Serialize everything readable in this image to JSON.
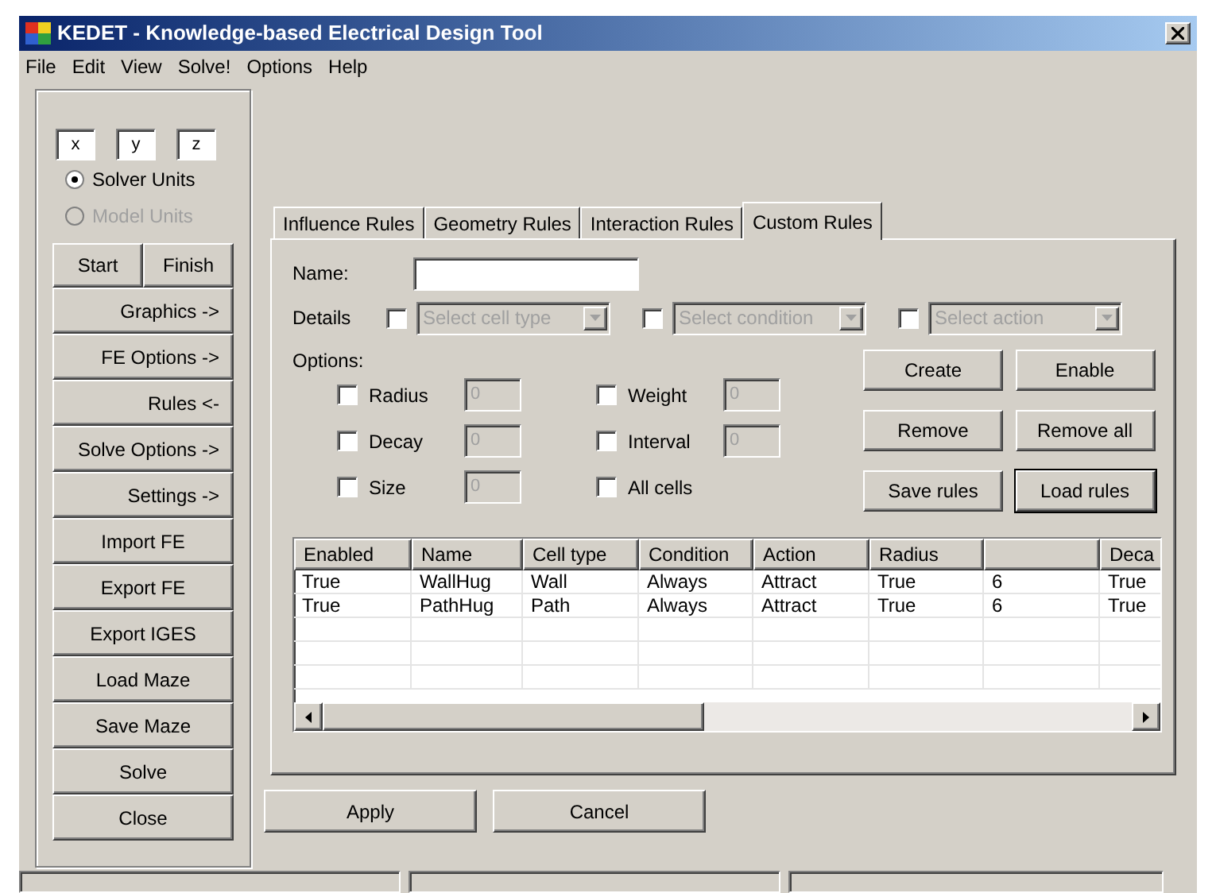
{
  "window": {
    "title": "KEDET - Knowledge-based Electrical Design Tool"
  },
  "menu": [
    "File",
    "Edit",
    "View",
    "Solve!",
    "Options",
    "Help"
  ],
  "left_panel": {
    "coordinates": [
      {
        "value": "x"
      },
      {
        "value": "y"
      },
      {
        "value": "z"
      }
    ],
    "units": [
      {
        "label": "Solver Units",
        "selected": true,
        "disabled": false
      },
      {
        "label": "Model Units",
        "selected": false,
        "disabled": true
      }
    ],
    "start_finish": [
      "Start",
      "Finish"
    ],
    "buttons": [
      {
        "label": "Graphics ->",
        "kind": "submenu"
      },
      {
        "label": "FE Options ->",
        "kind": "submenu"
      },
      {
        "label": "Rules <-",
        "kind": "submenu"
      },
      {
        "label": "Solve Options ->",
        "kind": "submenu"
      },
      {
        "label": "Settings ->",
        "kind": "submenu"
      },
      {
        "label": "Import FE",
        "kind": "action"
      },
      {
        "label": "Export FE",
        "kind": "action"
      },
      {
        "label": "Export IGES",
        "kind": "action"
      },
      {
        "label": "Load Maze",
        "kind": "action"
      },
      {
        "label": "Save Maze",
        "kind": "action"
      },
      {
        "label": "Solve",
        "kind": "action"
      },
      {
        "label": "Close",
        "kind": "action"
      }
    ]
  },
  "tabs": [
    {
      "label": "Influence Rules",
      "selected": false
    },
    {
      "label": "Geometry Rules",
      "selected": false
    },
    {
      "label": "Interaction Rules",
      "selected": false
    },
    {
      "label": "Custom Rules",
      "selected": true
    }
  ],
  "custom_rules": {
    "name_label": "Name:",
    "details_label": "Details",
    "details": [
      {
        "placeholder": "Select cell type",
        "checked": false,
        "disabled": true
      },
      {
        "placeholder": "Select condition",
        "checked": false,
        "disabled": true
      },
      {
        "placeholder": "Select action",
        "checked": false,
        "disabled": true
      }
    ],
    "options_label": "Options:",
    "options": [
      [
        {
          "label": "Radius",
          "checked": false,
          "kind": "field",
          "value": "0",
          "disabled": true
        },
        {
          "label": "Weight",
          "checked": false,
          "kind": "field",
          "value": "0",
          "disabled": true
        }
      ],
      [
        {
          "label": "Decay",
          "checked": false,
          "kind": "field",
          "value": "0",
          "disabled": true
        },
        {
          "label": "Interval",
          "checked": false,
          "kind": "field",
          "value": "0",
          "disabled": true
        }
      ],
      [
        {
          "label": "Size",
          "checked": false,
          "kind": "field",
          "value": "0",
          "disabled": true
        },
        {
          "label": "All cells",
          "checked": false,
          "kind": "plain"
        }
      ]
    ],
    "buttons": [
      {
        "label": "Create",
        "default": false
      },
      {
        "label": "Enable",
        "default": false
      },
      {
        "label": "Remove",
        "default": false
      },
      {
        "label": "Remove all",
        "default": false
      },
      {
        "label": "Save rules",
        "default": false
      },
      {
        "label": "Load rules",
        "default": true
      }
    ],
    "table": {
      "columns": [
        "Enabled",
        "Name",
        "Cell type",
        "Condition",
        "Action",
        "Radius",
        "",
        "Deca"
      ],
      "rows": [
        [
          "True",
          "WallHug",
          "Wall",
          "Always",
          "Attract",
          "True",
          "6",
          "True"
        ],
        [
          "True",
          "PathHug",
          "Path",
          "Always",
          "Attract",
          "True",
          "6",
          "True"
        ]
      ]
    }
  },
  "footer_buttons": [
    "Apply",
    "Cancel"
  ]
}
